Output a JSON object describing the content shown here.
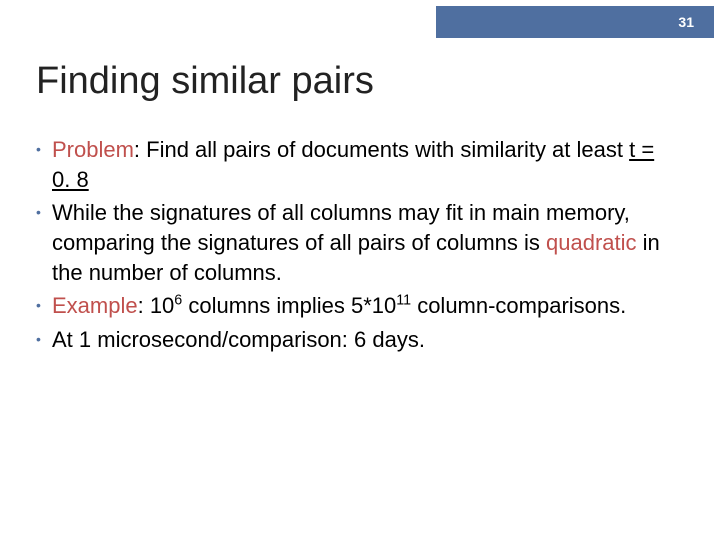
{
  "slide_number": "31",
  "title": "Finding similar pairs",
  "bullets": {
    "b1_problem": "Problem",
    "b1_mid": ": Find all pairs of documents with similarity at least ",
    "b1_t": "t = 0. 8",
    "b2_pre": "While the signatures of all columns may fit in main memory, comparing the signatures of all pairs of columns is ",
    "b2_quad": "quadratic",
    "b2_post": " in the number of columns.",
    "b3_example": "Example",
    "b3_pre": ": 10",
    "b3_exp1": "6",
    "b3_mid": " columns implies 5*10",
    "b3_exp2": "11",
    "b3_post": " column-comparisons.",
    "b4": "At 1 microsecond/comparison: 6 days."
  }
}
